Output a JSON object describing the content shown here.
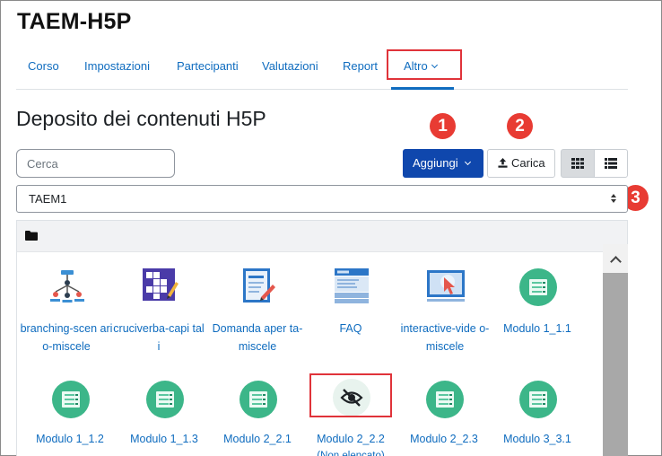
{
  "course": {
    "title": "TAEM-H5P"
  },
  "nav": {
    "items": [
      {
        "label": "Corso"
      },
      {
        "label": "Impostazioni"
      },
      {
        "label": "Partecipanti"
      },
      {
        "label": "Valutazioni"
      },
      {
        "label": "Report"
      },
      {
        "label": "Altro",
        "active": true
      }
    ]
  },
  "page": {
    "heading": "Deposito dei contenuti H5P"
  },
  "toolbar": {
    "search_placeholder": "Cerca",
    "add_label": "Aggiungi",
    "upload_label": "Carica",
    "view_modes": [
      "grid-view",
      "list-view"
    ],
    "active_view": "grid-view"
  },
  "repository": {
    "selected": "TAEM1"
  },
  "markers": [
    "1",
    "2",
    "3"
  ],
  "colors": {
    "primary": "#0f47ad",
    "link": "#0f6cbf",
    "highlight": "#e0333a",
    "marker": "#e83b33",
    "module_icon": "#3cb689"
  },
  "files": [
    {
      "label": "branching-scen ario-miscele",
      "icon": "branching-scenario-icon"
    },
    {
      "label": "cruciverba-capi tali",
      "icon": "crossword-icon"
    },
    {
      "label": "Domanda aper ta-miscele",
      "icon": "essay-question-icon"
    },
    {
      "label": "FAQ",
      "icon": "accordion-icon"
    },
    {
      "label": "interactive-vide o-miscele",
      "icon": "interactive-video-icon"
    },
    {
      "label": "Modulo 1_1.1",
      "icon": "module-icon"
    },
    {
      "label": "Modulo 1_1.2",
      "icon": "module-icon"
    },
    {
      "label": "Modulo 1_1.3",
      "icon": "module-icon"
    },
    {
      "label": "Modulo 2_2.1",
      "icon": "module-icon"
    },
    {
      "label": "Modulo 2_2.2",
      "icon": "eye-slash-icon",
      "status": "(Non elencato)"
    },
    {
      "label": "Modulo 2_2.3",
      "icon": "module-icon"
    },
    {
      "label": "Modulo 3_3.1",
      "icon": "module-icon"
    }
  ]
}
